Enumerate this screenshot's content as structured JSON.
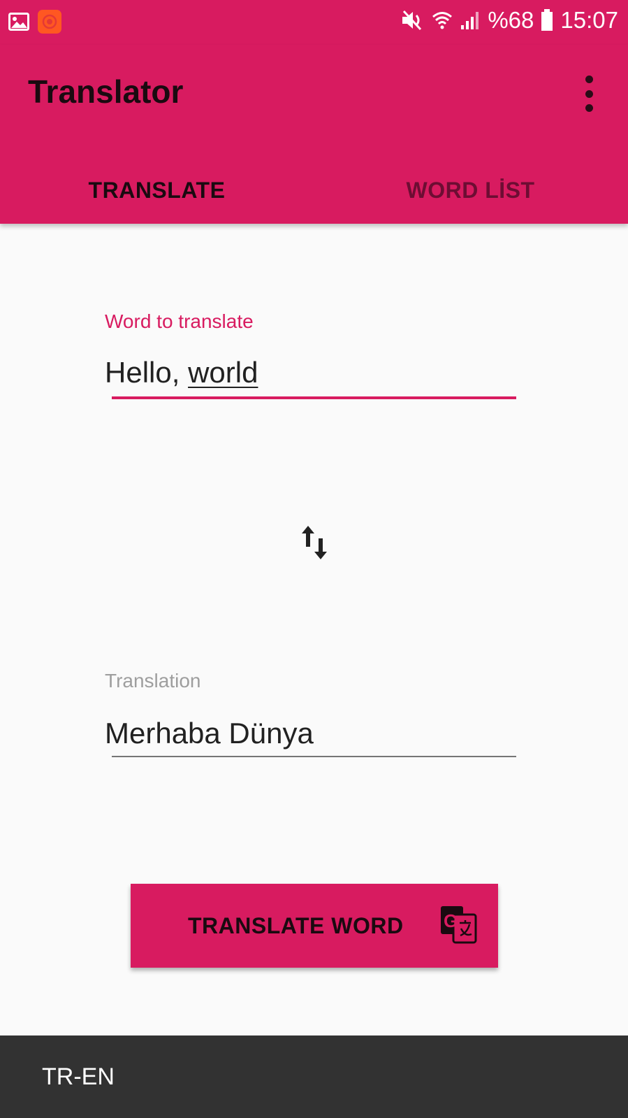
{
  "status_bar": {
    "battery_text": "%68",
    "time": "15:07",
    "icons": [
      "gallery-icon",
      "app-notification-icon",
      "mute-icon",
      "wifi-icon",
      "signal-icon",
      "battery-icon"
    ]
  },
  "app_bar": {
    "title": "Translator",
    "overflow_icon": "more-vert-icon"
  },
  "tabs": [
    {
      "label": "TRANSLATE",
      "selected": true
    },
    {
      "label": "WORD LİST",
      "selected": false
    }
  ],
  "word_field": {
    "label": "Word to translate",
    "value_part1": "Hello, ",
    "value_part2": "world"
  },
  "swap_icon": "swap-vert-icon",
  "translation_field": {
    "label": "Translation",
    "value": "Merhaba Dünya"
  },
  "translate_button": {
    "label": "TRANSLATE WORD",
    "icon": "google-translate-icon"
  },
  "bottom_bar": {
    "language_pair": "TR-EN"
  },
  "colors": {
    "primary": "#d81b60",
    "background": "#fafafa",
    "bottom_bar": "#323232"
  }
}
